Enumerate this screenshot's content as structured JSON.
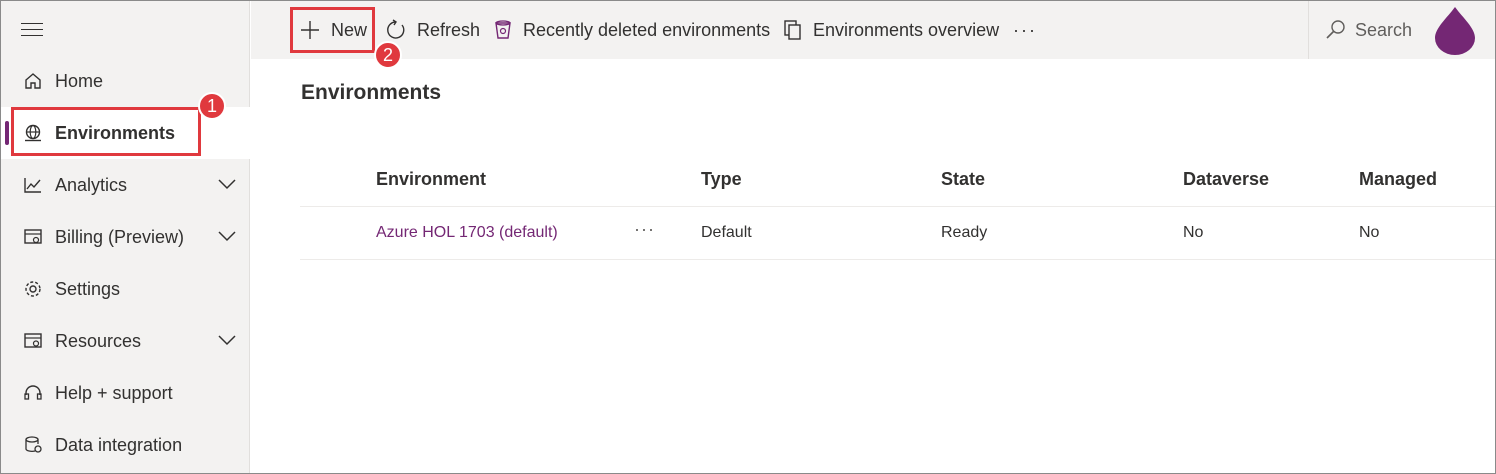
{
  "sidebar": {
    "items": [
      {
        "label": "Home",
        "icon": "home-icon"
      },
      {
        "label": "Environments",
        "icon": "globe-icon",
        "active": true
      },
      {
        "label": "Analytics",
        "icon": "analytics-icon",
        "expandable": true
      },
      {
        "label": "Billing (Preview)",
        "icon": "billing-icon",
        "expandable": true
      },
      {
        "label": "Settings",
        "icon": "gear-icon"
      },
      {
        "label": "Resources",
        "icon": "resources-icon",
        "expandable": true
      },
      {
        "label": "Help + support",
        "icon": "headset-icon"
      },
      {
        "label": "Data integration",
        "icon": "data-integration-icon"
      }
    ]
  },
  "toolbar": {
    "new_label": "New",
    "refresh_label": "Refresh",
    "recently_deleted_label": "Recently deleted environments",
    "overview_label": "Environments overview",
    "more_label": "···",
    "search_placeholder": "Search"
  },
  "callouts": {
    "one": "1",
    "two": "2"
  },
  "main": {
    "title": "Environments",
    "columns": [
      "Environment",
      "Type",
      "State",
      "Dataverse",
      "Managed"
    ],
    "rows": [
      {
        "environment": "Azure HOL 1703 (default)",
        "more": "···",
        "type": "Default",
        "state": "Ready",
        "dataverse": "No",
        "managed": "No"
      }
    ]
  },
  "colors": {
    "accent": "#742774",
    "callout": "#e0393e",
    "sidebar_bg": "#f3f2f1"
  }
}
